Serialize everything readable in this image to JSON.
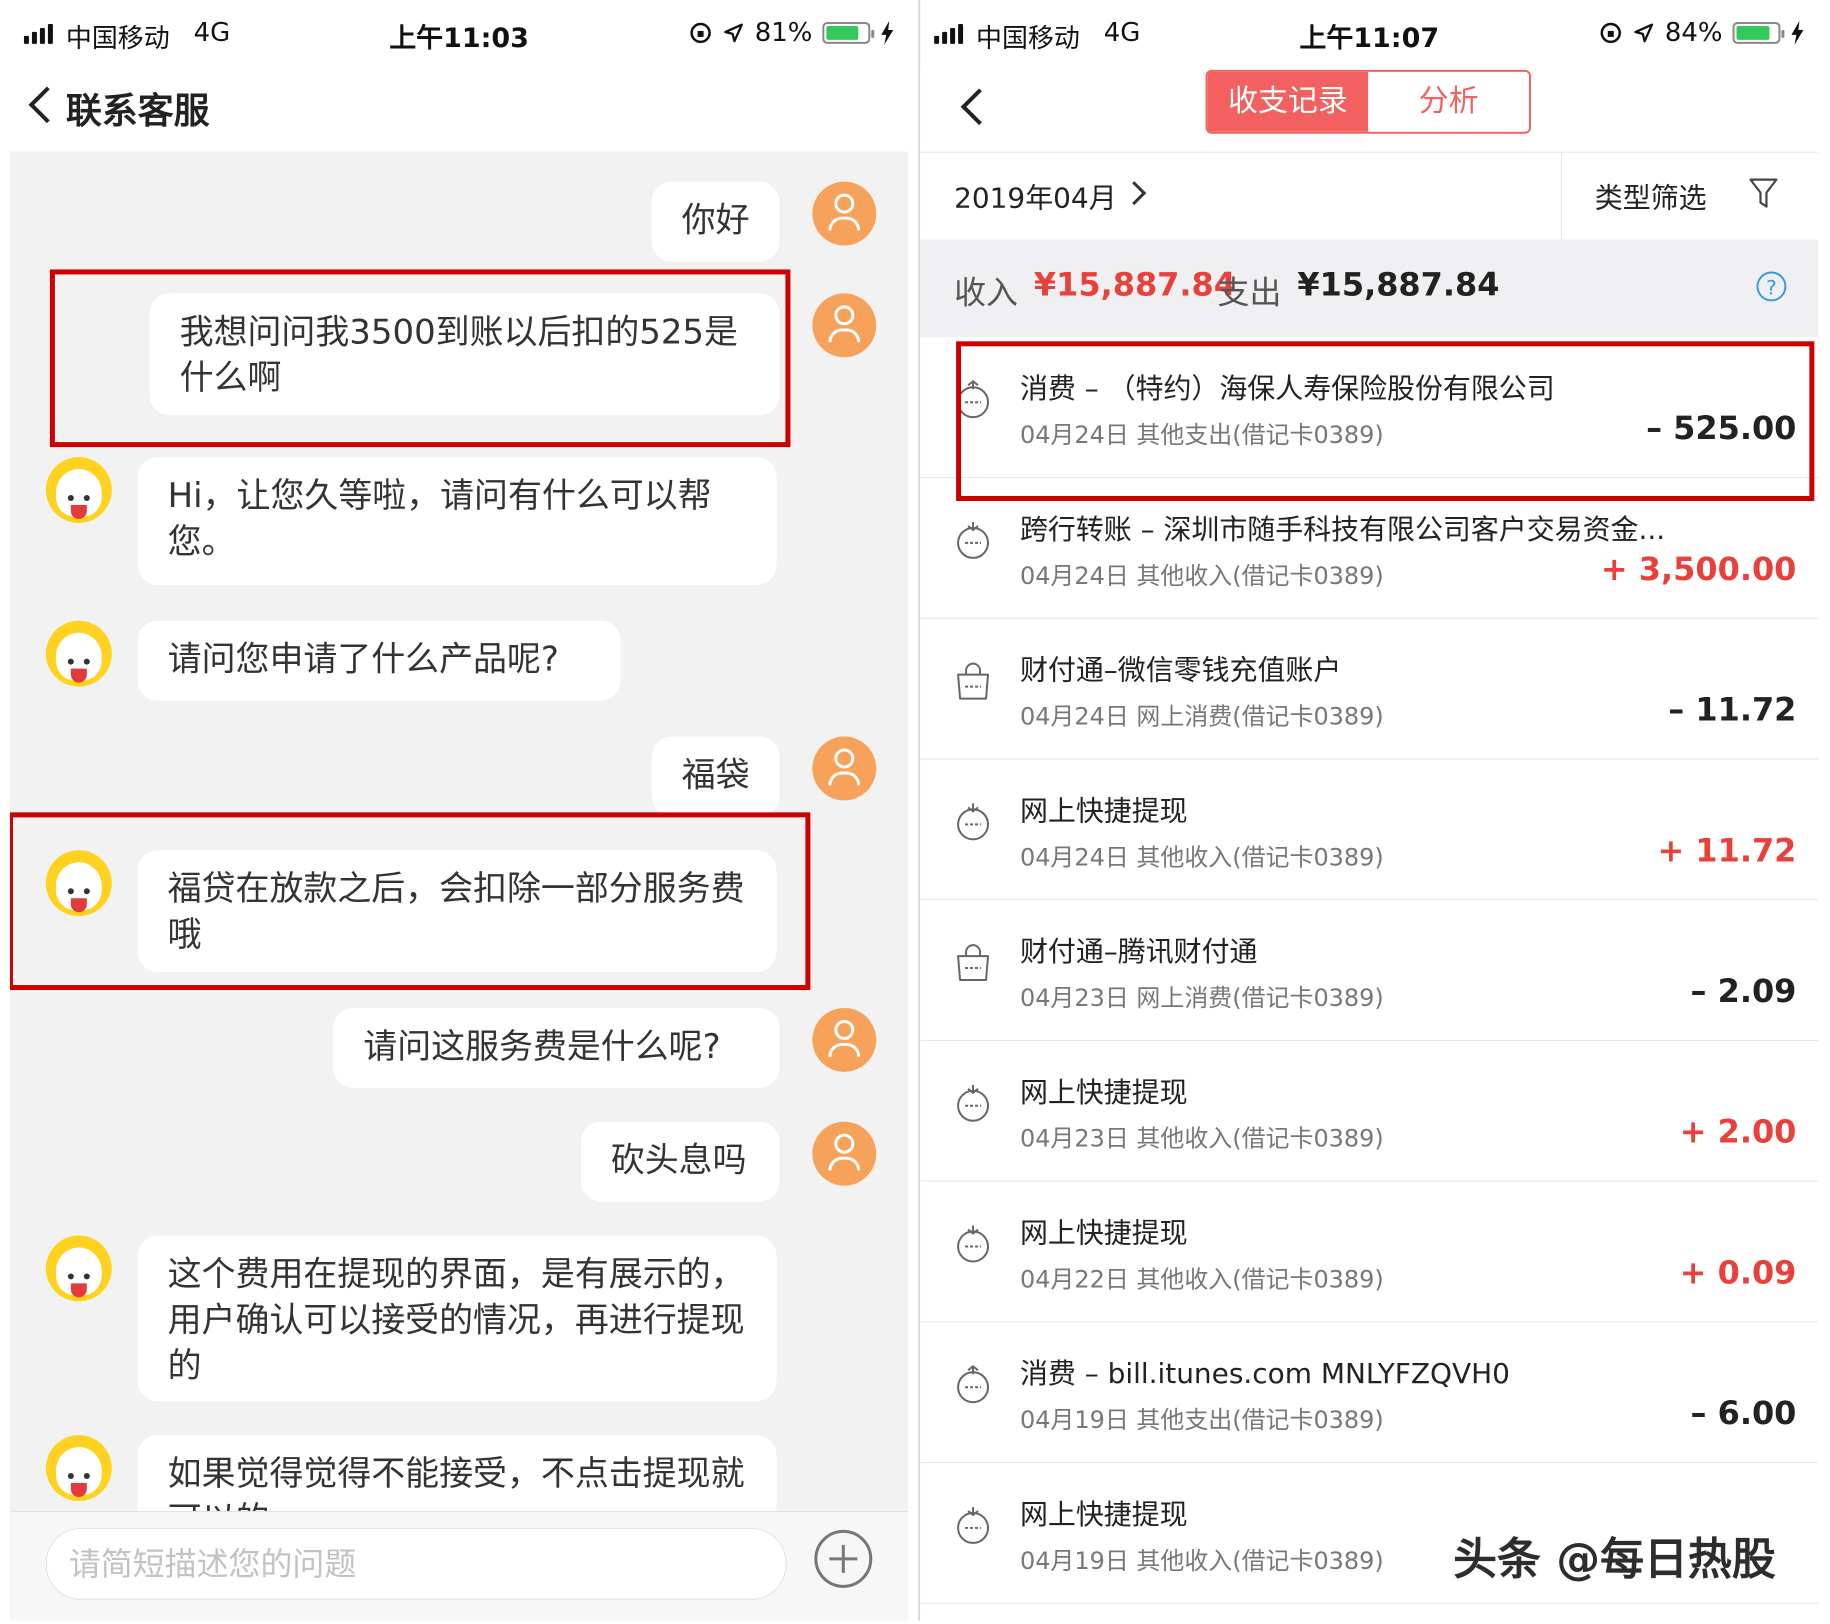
{
  "left": {
    "status": {
      "carrier": "中国移动",
      "network": "4G",
      "time": "上午11:03",
      "battery": "81%",
      "battery_level": 0.81
    },
    "nav": {
      "title": "联系客服"
    },
    "messages": [
      {
        "from": "user",
        "text": "你好"
      },
      {
        "from": "user",
        "text": "我想问问我3500到账以后扣的525是什么啊"
      },
      {
        "from": "bot",
        "text": "Hi，让您久等啦，请问有什么可以帮您。"
      },
      {
        "from": "bot",
        "text": "请问您申请了什么产品呢?"
      },
      {
        "from": "user",
        "text": "福袋"
      },
      {
        "from": "bot",
        "text": "福贷在放款之后，会扣除一部分服务费哦"
      },
      {
        "from": "user",
        "text": "请问这服务费是什么呢?"
      },
      {
        "from": "user",
        "text": "砍头息吗"
      },
      {
        "from": "bot",
        "text": "这个费用在提现的界面，是有展示的，用户确认可以接受的情况，再进行提现的"
      },
      {
        "from": "bot",
        "text": "如果觉得觉得不能接受，不点击提现就可以的"
      }
    ],
    "input": {
      "placeholder": "请简短描述您的问题"
    }
  },
  "right": {
    "status": {
      "carrier": "中国移动",
      "network": "4G",
      "time": "上午11:07",
      "battery": "84%",
      "battery_level": 0.84
    },
    "tabs": {
      "records": "收支记录",
      "analysis": "分析"
    },
    "filter": {
      "month": "2019年04月",
      "type_filter": "类型筛选"
    },
    "summary": {
      "income_label": "收入",
      "income": "¥15,887.84",
      "expense_label": "支出",
      "expense": "¥15,887.84"
    },
    "transactions": [
      {
        "title": "消费 – （特约）海保人寿保险股份有限公司",
        "meta": "04月24日 其他支出(借记卡0389)",
        "amount": "– 525.00",
        "type": "expense",
        "icon": "timer-out-icon"
      },
      {
        "title": "跨行转账 – 深圳市随手科技有限公司客户交易资金...",
        "meta": "04月24日 其他收入(借记卡0389)",
        "amount": "+ 3,500.00",
        "type": "income",
        "icon": "timer-in-icon"
      },
      {
        "title": "财付通–微信零钱充值账户",
        "meta": "04月24日 网上消费(借记卡0389)",
        "amount": "– 11.72",
        "type": "expense",
        "icon": "shopping-bag-icon"
      },
      {
        "title": "网上快捷提现",
        "meta": "04月24日 其他收入(借记卡0389)",
        "amount": "+ 11.72",
        "type": "income",
        "icon": "timer-in-icon"
      },
      {
        "title": "财付通–腾讯财付通",
        "meta": "04月23日 网上消费(借记卡0389)",
        "amount": "– 2.09",
        "type": "expense",
        "icon": "shopping-bag-icon"
      },
      {
        "title": "网上快捷提现",
        "meta": "04月23日 其他收入(借记卡0389)",
        "amount": "+ 2.00",
        "type": "income",
        "icon": "timer-in-icon"
      },
      {
        "title": "网上快捷提现",
        "meta": "04月22日 其他收入(借记卡0389)",
        "amount": "+ 0.09",
        "type": "income",
        "icon": "timer-in-icon"
      },
      {
        "title": "消费 – bill.itunes.com MNLYFZQVH0",
        "meta": "04月19日 其他支出(借记卡0389)",
        "amount": "– 6.00",
        "type": "expense",
        "icon": "timer-out-icon"
      },
      {
        "title": "网上快捷提现",
        "meta": "04月19日 其他收入(借记卡0389)",
        "amount": "",
        "type": "income",
        "icon": "timer-in-icon"
      }
    ]
  },
  "watermark": "头条 @每日热股",
  "colors": {
    "accent": "#f26060",
    "income": "#e8413c",
    "expense": "#222222",
    "highlight": "#cc0000",
    "user_avatar": "#f6a25a",
    "bot_avatar": "#ffd21f"
  }
}
